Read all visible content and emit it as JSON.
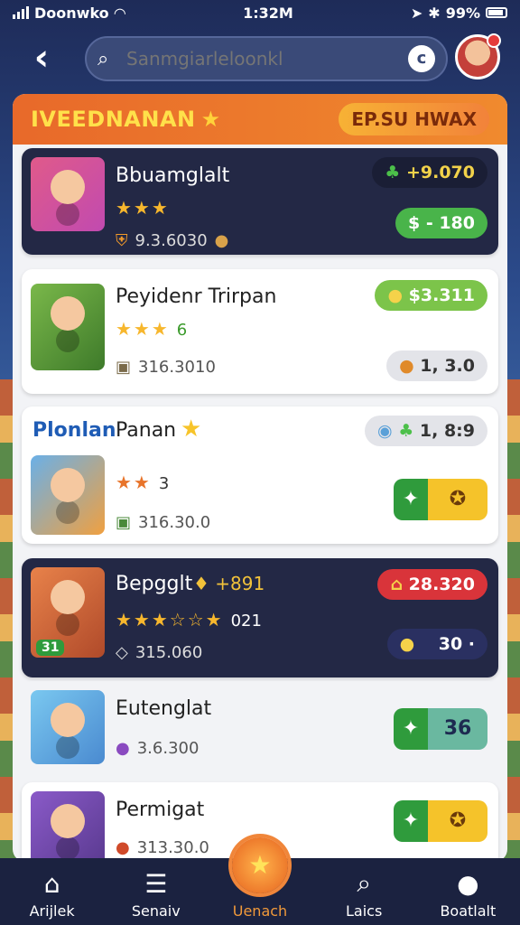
{
  "status": {
    "carrier": "Doonwko",
    "time": "1:32M",
    "battery": "99%"
  },
  "search": {
    "placeholder": "Sanmgiarleloonkl"
  },
  "panel": {
    "title": "IVEEDNANAN",
    "badge": "EP.SU HWAX"
  },
  "rows": [
    {
      "name": "Bbuamglalt",
      "stars": "★★★",
      "score": "9.3.6030",
      "pill1": "+9.070",
      "pill2": "$ - 180"
    },
    {
      "name": "Peyidenr Trirpan",
      "stars": "★★★",
      "star_num": "6",
      "score": "316.3010",
      "pill1": "$3.311",
      "pill2": "1, 3.0"
    },
    {
      "name": "Panan",
      "section": "Plonlan",
      "stars": "★★",
      "star_num": "3",
      "score": "316.30.0",
      "pill1": "1, 8:9"
    },
    {
      "name": "Bepgglt",
      "extra": "+891",
      "stars": "★★★☆☆★",
      "star_num": "021",
      "score": "315.060",
      "pill1": "28.320",
      "pill2": "30 ·",
      "thumb_badge": "31"
    },
    {
      "name": "Eutenglat",
      "score": "3.6.300",
      "action_b": "36"
    },
    {
      "name": "Permigat",
      "score": "313.30.0"
    }
  ],
  "nav": [
    {
      "label": "Arijlek",
      "icon": "home-icon"
    },
    {
      "label": "Senaiv",
      "icon": "list-icon"
    },
    {
      "label": "Uenach",
      "icon": "star-icon"
    },
    {
      "label": "Laics",
      "icon": "search-icon"
    },
    {
      "label": "Boatlalt",
      "icon": "profile-icon"
    }
  ],
  "colors": {
    "accent": "#f08a2e",
    "green": "#49b44a",
    "navy": "#232845"
  }
}
